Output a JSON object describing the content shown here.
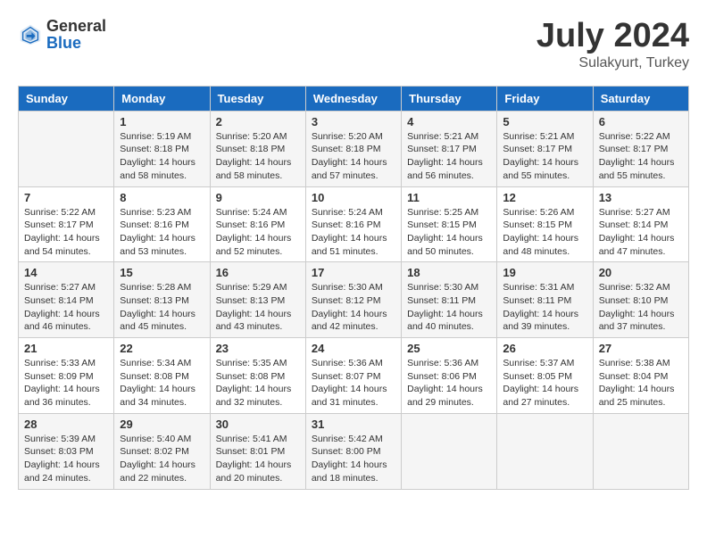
{
  "header": {
    "logo_general": "General",
    "logo_blue": "Blue",
    "title": "July 2024",
    "location": "Sulakyurt, Turkey"
  },
  "calendar": {
    "days_of_week": [
      "Sunday",
      "Monday",
      "Tuesday",
      "Wednesday",
      "Thursday",
      "Friday",
      "Saturday"
    ],
    "weeks": [
      [
        {
          "day": "",
          "info": ""
        },
        {
          "day": "1",
          "info": "Sunrise: 5:19 AM\nSunset: 8:18 PM\nDaylight: 14 hours\nand 58 minutes."
        },
        {
          "day": "2",
          "info": "Sunrise: 5:20 AM\nSunset: 8:18 PM\nDaylight: 14 hours\nand 58 minutes."
        },
        {
          "day": "3",
          "info": "Sunrise: 5:20 AM\nSunset: 8:18 PM\nDaylight: 14 hours\nand 57 minutes."
        },
        {
          "day": "4",
          "info": "Sunrise: 5:21 AM\nSunset: 8:17 PM\nDaylight: 14 hours\nand 56 minutes."
        },
        {
          "day": "5",
          "info": "Sunrise: 5:21 AM\nSunset: 8:17 PM\nDaylight: 14 hours\nand 55 minutes."
        },
        {
          "day": "6",
          "info": "Sunrise: 5:22 AM\nSunset: 8:17 PM\nDaylight: 14 hours\nand 55 minutes."
        }
      ],
      [
        {
          "day": "7",
          "info": "Sunrise: 5:22 AM\nSunset: 8:17 PM\nDaylight: 14 hours\nand 54 minutes."
        },
        {
          "day": "8",
          "info": "Sunrise: 5:23 AM\nSunset: 8:16 PM\nDaylight: 14 hours\nand 53 minutes."
        },
        {
          "day": "9",
          "info": "Sunrise: 5:24 AM\nSunset: 8:16 PM\nDaylight: 14 hours\nand 52 minutes."
        },
        {
          "day": "10",
          "info": "Sunrise: 5:24 AM\nSunset: 8:16 PM\nDaylight: 14 hours\nand 51 minutes."
        },
        {
          "day": "11",
          "info": "Sunrise: 5:25 AM\nSunset: 8:15 PM\nDaylight: 14 hours\nand 50 minutes."
        },
        {
          "day": "12",
          "info": "Sunrise: 5:26 AM\nSunset: 8:15 PM\nDaylight: 14 hours\nand 48 minutes."
        },
        {
          "day": "13",
          "info": "Sunrise: 5:27 AM\nSunset: 8:14 PM\nDaylight: 14 hours\nand 47 minutes."
        }
      ],
      [
        {
          "day": "14",
          "info": "Sunrise: 5:27 AM\nSunset: 8:14 PM\nDaylight: 14 hours\nand 46 minutes."
        },
        {
          "day": "15",
          "info": "Sunrise: 5:28 AM\nSunset: 8:13 PM\nDaylight: 14 hours\nand 45 minutes."
        },
        {
          "day": "16",
          "info": "Sunrise: 5:29 AM\nSunset: 8:13 PM\nDaylight: 14 hours\nand 43 minutes."
        },
        {
          "day": "17",
          "info": "Sunrise: 5:30 AM\nSunset: 8:12 PM\nDaylight: 14 hours\nand 42 minutes."
        },
        {
          "day": "18",
          "info": "Sunrise: 5:30 AM\nSunset: 8:11 PM\nDaylight: 14 hours\nand 40 minutes."
        },
        {
          "day": "19",
          "info": "Sunrise: 5:31 AM\nSunset: 8:11 PM\nDaylight: 14 hours\nand 39 minutes."
        },
        {
          "day": "20",
          "info": "Sunrise: 5:32 AM\nSunset: 8:10 PM\nDaylight: 14 hours\nand 37 minutes."
        }
      ],
      [
        {
          "day": "21",
          "info": "Sunrise: 5:33 AM\nSunset: 8:09 PM\nDaylight: 14 hours\nand 36 minutes."
        },
        {
          "day": "22",
          "info": "Sunrise: 5:34 AM\nSunset: 8:08 PM\nDaylight: 14 hours\nand 34 minutes."
        },
        {
          "day": "23",
          "info": "Sunrise: 5:35 AM\nSunset: 8:08 PM\nDaylight: 14 hours\nand 32 minutes."
        },
        {
          "day": "24",
          "info": "Sunrise: 5:36 AM\nSunset: 8:07 PM\nDaylight: 14 hours\nand 31 minutes."
        },
        {
          "day": "25",
          "info": "Sunrise: 5:36 AM\nSunset: 8:06 PM\nDaylight: 14 hours\nand 29 minutes."
        },
        {
          "day": "26",
          "info": "Sunrise: 5:37 AM\nSunset: 8:05 PM\nDaylight: 14 hours\nand 27 minutes."
        },
        {
          "day": "27",
          "info": "Sunrise: 5:38 AM\nSunset: 8:04 PM\nDaylight: 14 hours\nand 25 minutes."
        }
      ],
      [
        {
          "day": "28",
          "info": "Sunrise: 5:39 AM\nSunset: 8:03 PM\nDaylight: 14 hours\nand 24 minutes."
        },
        {
          "day": "29",
          "info": "Sunrise: 5:40 AM\nSunset: 8:02 PM\nDaylight: 14 hours\nand 22 minutes."
        },
        {
          "day": "30",
          "info": "Sunrise: 5:41 AM\nSunset: 8:01 PM\nDaylight: 14 hours\nand 20 minutes."
        },
        {
          "day": "31",
          "info": "Sunrise: 5:42 AM\nSunset: 8:00 PM\nDaylight: 14 hours\nand 18 minutes."
        },
        {
          "day": "",
          "info": ""
        },
        {
          "day": "",
          "info": ""
        },
        {
          "day": "",
          "info": ""
        }
      ]
    ]
  }
}
